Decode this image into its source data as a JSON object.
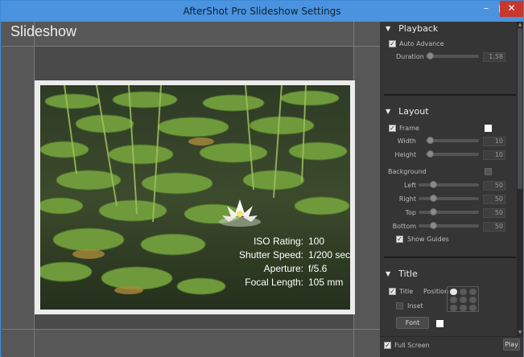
{
  "window": {
    "title": "AfterShot Pro Slideshow Settings",
    "controls": {
      "minimize": "–",
      "maximize": "□",
      "close": "✕"
    }
  },
  "preview": {
    "heading": "Slideshow",
    "exif": [
      {
        "label": "ISO Rating:",
        "value": "100"
      },
      {
        "label": "Shutter Speed:",
        "value": "1/200 sec"
      },
      {
        "label": "Aperture:",
        "value": "f/5.6"
      },
      {
        "label": "Focal Length:",
        "value": "105 mm"
      }
    ]
  },
  "panel": {
    "playback": {
      "header": "Playback",
      "auto_advance_label": "Auto Advance",
      "auto_advance_checked": true,
      "duration_label": "Duration",
      "duration_value": "1.58",
      "duration_level": 0.05
    },
    "layout": {
      "header": "Layout",
      "frame_label": "Frame",
      "frame_checked": true,
      "frame_color": "#ffffff",
      "width_label": "Width",
      "width_value": "10",
      "height_label": "Height",
      "height_value": "10",
      "background_label": "Background",
      "background_color": "#555555",
      "left_label": "Left",
      "left_value": "50",
      "right_label": "Right",
      "right_value": "50",
      "top_label": "Top",
      "top_value": "50",
      "bottom_label": "Bottom",
      "bottom_value": "50",
      "show_guides_label": "Show Guides",
      "show_guides_checked": true
    },
    "title": {
      "header": "Title",
      "title_label": "Title",
      "title_checked": true,
      "position_label": "Position",
      "inset_label": "Inset",
      "inset_checked": false,
      "font_button": "Font",
      "title_color": "#ffffff"
    }
  },
  "footer": {
    "full_screen_label": "Full Screen",
    "full_screen_checked": true,
    "play_button": "Play"
  },
  "colors": {
    "titlebar": "#4b93df",
    "close": "#c7372b",
    "panel_bg": "#353535",
    "preview_bg": "#575757"
  }
}
